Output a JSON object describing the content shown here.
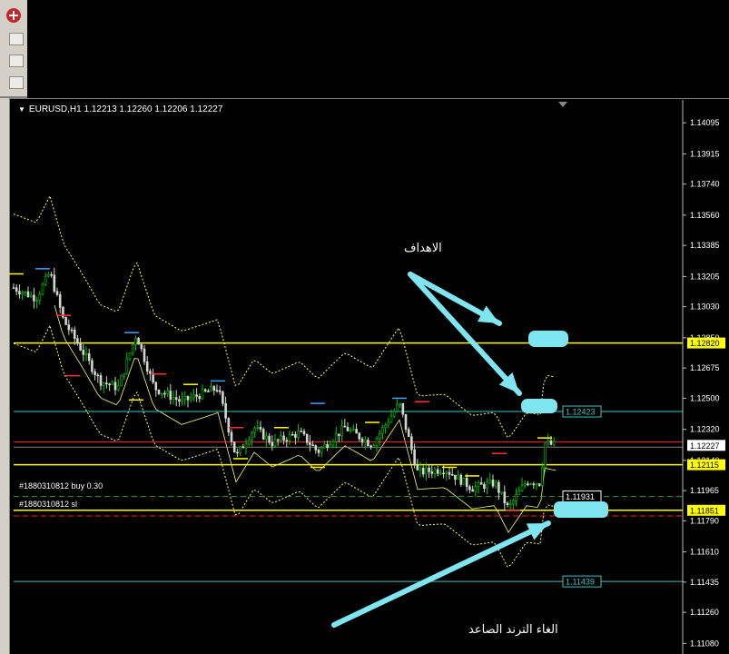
{
  "chart": {
    "symbol_label": "EURUSD,H1  1.12213 1.12260 1.12206 1.12227"
  },
  "price_scale": {
    "ticks": [
      "1.14095",
      "1.13915",
      "1.13740",
      "1.13560",
      "1.13385",
      "1.13205",
      "1.13030",
      "1.12850",
      "1.12675",
      "1.12500",
      "1.12320",
      "1.12140",
      "1.11965",
      "1.11790",
      "1.11610",
      "1.11435",
      "1.11260",
      "1.11080"
    ],
    "price_top": 1.14175,
    "price_bottom": 1.11045
  },
  "levels": [
    {
      "price": "1.12820",
      "kind": "hline",
      "color": "#ffff00",
      "label_style": "filled"
    },
    {
      "price": "1.12423",
      "kind": "hline",
      "color": "#40c0c0",
      "label_style": "outline"
    },
    {
      "price": "1.12227",
      "kind": "current",
      "color": "#ffffff",
      "label_style": "filled"
    },
    {
      "price": "1.12115",
      "kind": "hline",
      "color": "#ffff00",
      "label_style": "filled"
    },
    {
      "price": "1.11931",
      "kind": "order",
      "color": "#ffffff",
      "label_style": "outline"
    },
    {
      "price": "1.11851",
      "kind": "hline",
      "color": "#ffff00",
      "label_style": "filled"
    },
    {
      "price": "1.11439",
      "kind": "hline",
      "color": "#40c0c0",
      "label_style": "outline"
    }
  ],
  "orders": [
    {
      "label": "#1880310812 buy 0.30",
      "price": 1.11931,
      "color": "#30a030"
    },
    {
      "label": "#1880310812 sl",
      "price": 1.11818,
      "color": "#ff2020"
    }
  ],
  "red_level_price": 1.12248,
  "annotations": {
    "targets_label": "الاهداف",
    "trend_cancel_label": "الغاء الترند الصاعد",
    "accent_color": "#7fe5f0"
  },
  "colors": {
    "bull_candle": "#00cc00",
    "bear_candle": "#cfd7cf",
    "band": "#ffff66"
  }
}
